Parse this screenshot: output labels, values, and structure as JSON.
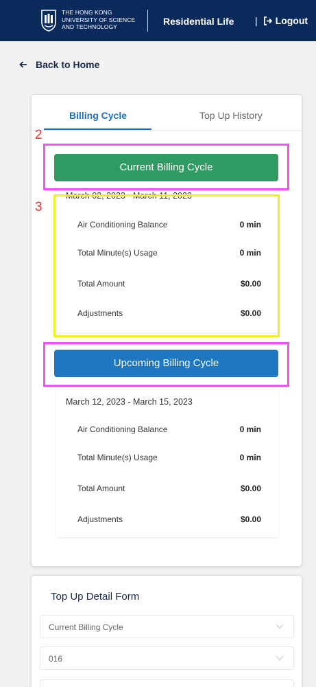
{
  "header": {
    "logo_text": "THE HONG KONG\nUNIVERSITY OF SCIENCE\nAND TECHNOLOGY",
    "title": "Residential Life",
    "logout_sep": "|",
    "logout_label": "Logout",
    "background_color": "#0a2a5c"
  },
  "nav": {
    "back_label": "Back to Home"
  },
  "tabs": [
    {
      "label": "Billing Cycle",
      "active": true
    },
    {
      "label": "Top Up History",
      "active": false
    }
  ],
  "annotations": {
    "label_2": "2",
    "label_3": "3"
  },
  "current_cycle": {
    "button_label": "Current Billing Cycle",
    "button_color": "#2f9b63",
    "date_range": "March 02, 2023 - March 11, 2023",
    "rows": [
      {
        "label": "Air Conditioning Balance",
        "value": "0 min"
      },
      {
        "label": "Total Minute(s) Usage",
        "value": "0 min"
      },
      {
        "label": "Total Amount",
        "value": "$0.00"
      },
      {
        "label": "Adjustments",
        "value": "$0.00"
      }
    ]
  },
  "upcoming_cycle": {
    "button_label": "Upcoming Billing Cycle",
    "button_color": "#1f77c0",
    "date_range": "March 12, 2023 - March 15, 2023",
    "rows": [
      {
        "label": "Air Conditioning Balance",
        "value": "0 min"
      },
      {
        "label": "Total Minute(s) Usage",
        "value": "0 min"
      },
      {
        "label": "Total Amount",
        "value": "$0.00"
      },
      {
        "label": "Adjustments",
        "value": "$0.00"
      }
    ]
  },
  "topup_form": {
    "title": "Top Up Detail Form",
    "cycle_select": "Current Billing Cycle",
    "room_select": "016",
    "third_select": ""
  }
}
